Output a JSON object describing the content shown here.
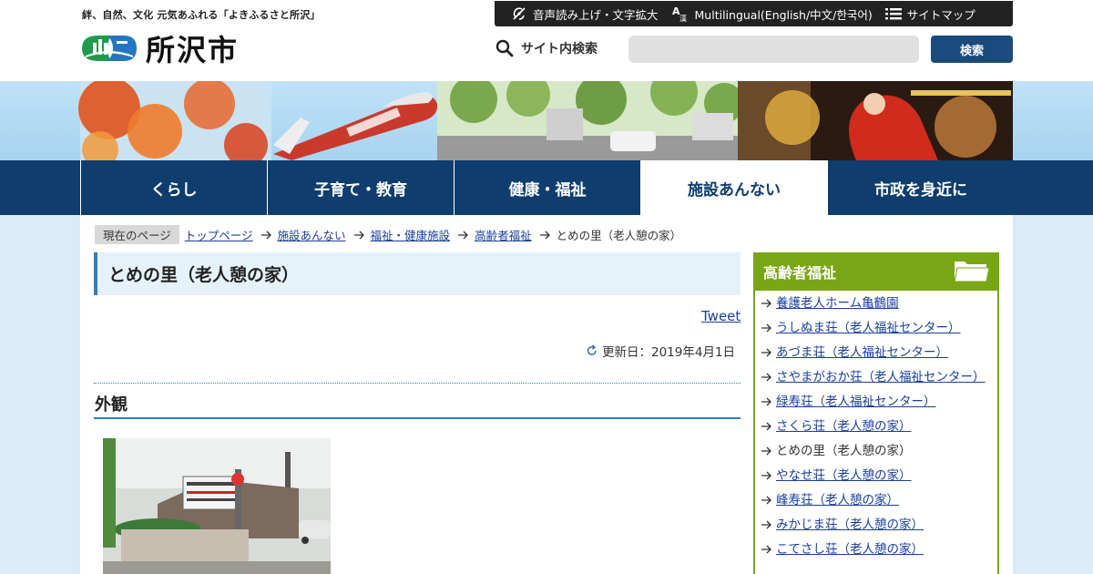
{
  "header": {
    "tagline": "絆、自然、文化 元気あふれる「よきふるさと所沢」",
    "logo_text": "所沢市",
    "logo_icon": "tokorozawa-city-emblem"
  },
  "utility_bar": {
    "items": [
      {
        "icon": "speech-off-icon",
        "label": "音声読み上げ・文字拡大"
      },
      {
        "icon": "translate-icon",
        "label": "Multilingual(English/中文/한국어)"
      },
      {
        "icon": "list-icon",
        "label": "サイトマップ"
      }
    ],
    "background": "#222222"
  },
  "search": {
    "label": "サイト内検索",
    "placeholder": "",
    "value": "",
    "button_label": "検索",
    "button_color": "#1b4a7d"
  },
  "global_nav": {
    "items": [
      {
        "label": "くらし",
        "active": false
      },
      {
        "label": "子育て・教育",
        "active": false
      },
      {
        "label": "健康・福祉",
        "active": false
      },
      {
        "label": "施設あんない",
        "active": true
      },
      {
        "label": "市政を身近に",
        "active": false
      }
    ],
    "background": "#0f3d6e"
  },
  "breadcrumb": {
    "here_label": "現在のページ",
    "links": [
      "トップページ",
      "施設あんない",
      "福祉・健康施設",
      "高齢者福祉"
    ],
    "current": "とめの里（老人憩の家）"
  },
  "main": {
    "page_title": "とめの里（老人憩の家）",
    "tweet_label": "Tweet",
    "updated_label": "更新日：2019年4月1日",
    "section_title": "外観"
  },
  "side_menu": {
    "title": "高齢者福祉",
    "title_icon": "folder-icon",
    "accent": "#79a616",
    "items": [
      {
        "label": "養護老人ホーム亀鶴園",
        "current": false
      },
      {
        "label": "うしぬま荘（老人福祉センター）",
        "current": false
      },
      {
        "label": "あづま荘（老人福祉センター）",
        "current": false
      },
      {
        "label": "さやまがおか荘（老人福祉センター）",
        "current": false
      },
      {
        "label": "緑寿荘（老人福祉センター）",
        "current": false
      },
      {
        "label": "さくら荘（老人憩の家）",
        "current": false
      },
      {
        "label": "とめの里（老人憩の家）",
        "current": true
      },
      {
        "label": "やなせ荘（老人憩の家）",
        "current": false
      },
      {
        "label": "峰寿荘（老人憩の家）",
        "current": false
      },
      {
        "label": "みかじま荘（老人憩の家）",
        "current": false
      },
      {
        "label": "こてさし荘（老人憩の家）",
        "current": false
      }
    ]
  },
  "colors": {
    "link": "#1a3f9c",
    "title_accent": "#2f7cc1",
    "title_bg": "#e6f2fa"
  }
}
